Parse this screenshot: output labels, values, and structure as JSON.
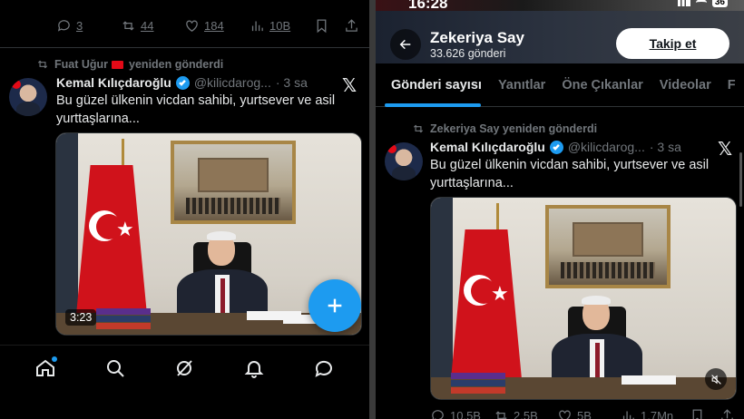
{
  "left": {
    "top_actions": {
      "replies": "3",
      "reposts": "44",
      "likes": "184",
      "views": "10B"
    },
    "repost_by": "Fuat Uğur",
    "repost_suffix": "yeniden gönderdi",
    "tweet": {
      "author": "Kemal Kılıçdaroğlu",
      "handle": "@kilicdarog...",
      "time": "· 3 sa",
      "text": "Bu güzel ülkenin vicdan sahibi, yurtsever ve asil yurttaşlarına...",
      "video_duration": "3:23"
    },
    "fab_icon": "plus-icon",
    "nav": [
      "home-icon",
      "search-icon",
      "grok-icon",
      "notifications-icon",
      "messages-icon"
    ]
  },
  "right": {
    "status_time": "16:28",
    "battery": "36",
    "profile": {
      "name": "Zekeriya Say",
      "posts": "33.626 gönderi",
      "follow_label": "Takip et"
    },
    "tabs": [
      "Gönderi sayısı",
      "Yanıtlar",
      "Öne Çıkanlar",
      "Videolar",
      "F"
    ],
    "repost_line": "Zekeriya Say yeniden gönderdi",
    "tweet": {
      "author": "Kemal Kılıçdaroğlu",
      "handle": "@kilicdarog...",
      "time": "· 3 sa",
      "text": "Bu güzel ülkenin vicdan sahibi, yurtsever ve asil yurttaşlarına..."
    },
    "bottom_actions": {
      "replies": "10,5B",
      "reposts": "2,5B",
      "likes": "5B",
      "views": "1,7Mn"
    }
  },
  "colors": {
    "accent": "#1d9bf0",
    "flag_red": "#d0121b",
    "muted": "#71767b"
  }
}
